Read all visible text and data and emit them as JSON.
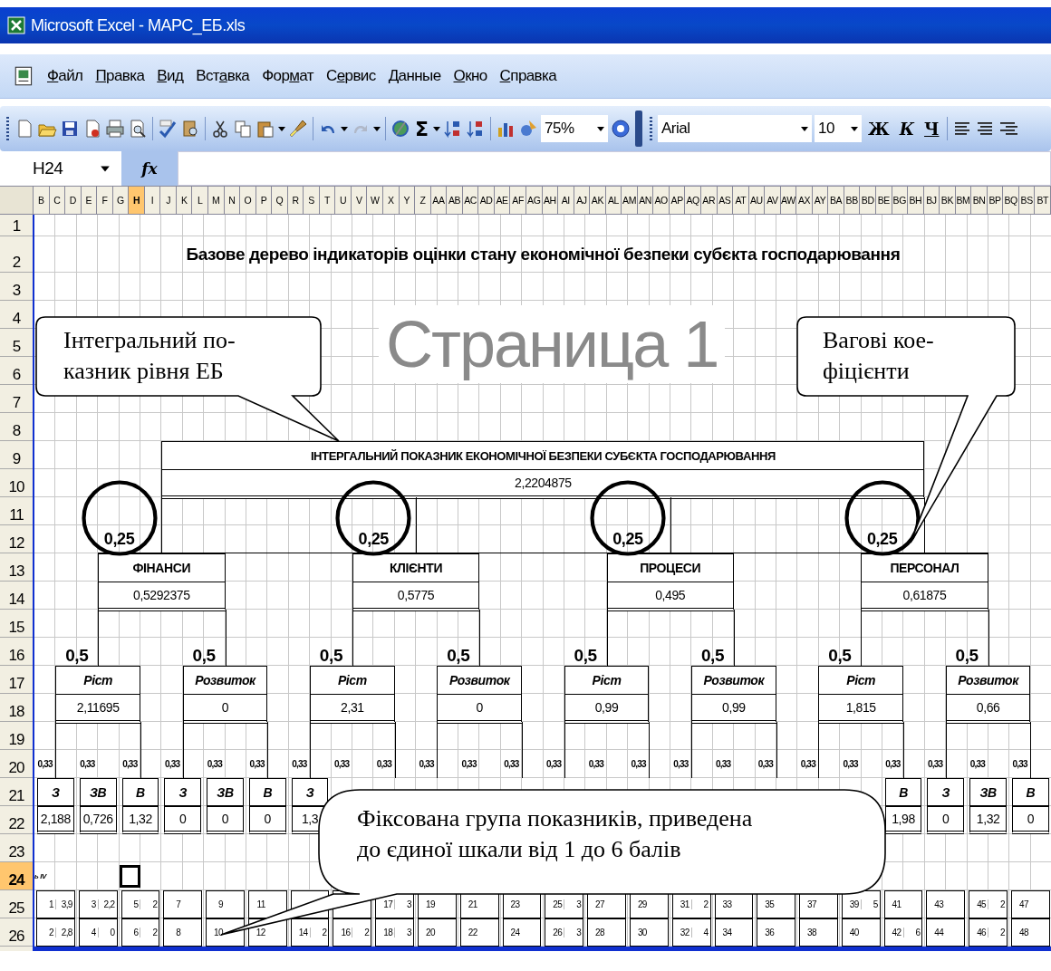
{
  "window": {
    "title": "Microsoft Excel - МАРС_ЕБ.xls"
  },
  "menu": [
    {
      "label": "Файл"
    },
    {
      "label": "Правка"
    },
    {
      "label": "Вид"
    },
    {
      "label": "Вставка"
    },
    {
      "label": "Формат"
    },
    {
      "label": "Сервис"
    },
    {
      "label": "Данные"
    },
    {
      "label": "Окно"
    },
    {
      "label": "Справка"
    }
  ],
  "toolbar": {
    "sum": "Σ",
    "zoom": "75%",
    "font": "Arial",
    "size": "10",
    "bold": "Ж",
    "italic": "К",
    "underline": "Ч"
  },
  "formula_bar": {
    "cell": "H24",
    "function_label": "fx"
  },
  "columns": [
    {
      "label": "B",
      "selected": false
    },
    {
      "label": "C",
      "selected": false
    },
    {
      "label": "D",
      "selected": false
    },
    {
      "label": "E",
      "selected": false
    },
    {
      "label": "F",
      "selected": false
    },
    {
      "label": "G",
      "selected": false
    },
    {
      "label": "H",
      "selected": true
    },
    {
      "label": "I",
      "selected": false
    },
    {
      "label": "J",
      "selected": false
    },
    {
      "label": "K",
      "selected": false
    },
    {
      "label": "L",
      "selected": false
    },
    {
      "label": "M",
      "selected": false
    },
    {
      "label": "N",
      "selected": false
    },
    {
      "label": "O",
      "selected": false
    },
    {
      "label": "P",
      "selected": false
    },
    {
      "label": "Q",
      "selected": false
    },
    {
      "label": "R",
      "selected": false
    },
    {
      "label": "S",
      "selected": false
    },
    {
      "label": "T",
      "selected": false
    },
    {
      "label": "U",
      "selected": false
    },
    {
      "label": "V",
      "selected": false
    },
    {
      "label": "W",
      "selected": false
    },
    {
      "label": "X",
      "selected": false
    },
    {
      "label": "Y",
      "selected": false
    },
    {
      "label": "Z",
      "selected": false
    },
    {
      "label": "AA",
      "selected": false
    },
    {
      "label": "AB",
      "selected": false
    },
    {
      "label": "AC",
      "selected": false
    },
    {
      "label": "AD",
      "selected": false
    },
    {
      "label": "AE",
      "selected": false
    },
    {
      "label": "AF",
      "selected": false
    },
    {
      "label": "AG",
      "selected": false
    },
    {
      "label": "AH",
      "selected": false
    },
    {
      "label": "AI",
      "selected": false
    },
    {
      "label": "AJ",
      "selected": false
    },
    {
      "label": "AK",
      "selected": false
    },
    {
      "label": "AL",
      "selected": false
    },
    {
      "label": "AM",
      "selected": false
    },
    {
      "label": "AN",
      "selected": false
    },
    {
      "label": "AO",
      "selected": false
    },
    {
      "label": "AP",
      "selected": false
    },
    {
      "label": "AQ",
      "selected": false
    },
    {
      "label": "AR",
      "selected": false
    },
    {
      "label": "AS",
      "selected": false
    },
    {
      "label": "AT",
      "selected": false
    },
    {
      "label": "AU",
      "selected": false
    },
    {
      "label": "AV",
      "selected": false
    },
    {
      "label": "AW",
      "selected": false
    },
    {
      "label": "AX",
      "selected": false
    },
    {
      "label": "AY",
      "selected": false
    },
    {
      "label": "BA",
      "selected": false
    },
    {
      "label": "BB",
      "selected": false
    },
    {
      "label": "BD",
      "selected": false
    },
    {
      "label": "BE",
      "selected": false
    },
    {
      "label": "BG",
      "selected": false
    },
    {
      "label": "BH",
      "selected": false
    },
    {
      "label": "BJ",
      "selected": false
    },
    {
      "label": "BK",
      "selected": false
    },
    {
      "label": "BM",
      "selected": false
    },
    {
      "label": "BN",
      "selected": false
    },
    {
      "label": "BP",
      "selected": false
    },
    {
      "label": "BQ",
      "selected": false
    },
    {
      "label": "BS",
      "selected": false
    },
    {
      "label": "BT",
      "selected": false
    }
  ],
  "rows": [
    {
      "label": "1",
      "selected": false
    },
    {
      "label": "2",
      "selected": false
    },
    {
      "label": "3",
      "selected": false
    },
    {
      "label": "4",
      "selected": false
    },
    {
      "label": "5",
      "selected": false
    },
    {
      "label": "6",
      "selected": false
    },
    {
      "label": "7",
      "selected": false
    },
    {
      "label": "8",
      "selected": false
    },
    {
      "label": "9",
      "selected": false
    },
    {
      "label": "10",
      "selected": false
    },
    {
      "label": "11",
      "selected": false
    },
    {
      "label": "12",
      "selected": false
    },
    {
      "label": "13",
      "selected": false
    },
    {
      "label": "14",
      "selected": false
    },
    {
      "label": "15",
      "selected": false
    },
    {
      "label": "16",
      "selected": false
    },
    {
      "label": "17",
      "selected": false
    },
    {
      "label": "18",
      "selected": false
    },
    {
      "label": "19",
      "selected": false
    },
    {
      "label": "20",
      "selected": false
    },
    {
      "label": "21",
      "selected": false
    },
    {
      "label": "22",
      "selected": false
    },
    {
      "label": "23",
      "selected": false
    },
    {
      "label": "24",
      "selected": true
    },
    {
      "label": "25",
      "selected": false
    },
    {
      "label": "26",
      "selected": false
    }
  ],
  "sheet": {
    "title": "Базове дерево індикаторів оцінки стану економічної безпеки субєкта господарювання",
    "root": {
      "label": "ІНТЕРГАЛЬНИЙ ПОКАЗНИК ЕКОНОМІЧНОЇ БЕЗПЕКИ СУБЄКТА ГОСПОДАРЮВАННЯ",
      "value": "2,2204875"
    },
    "branches": [
      {
        "weight": "0,25",
        "circled": true,
        "label": "ФІНАНСИ",
        "value": "0,5292375",
        "subs": [
          {
            "weight": "0,5",
            "label": "Ріст",
            "value": "2,11695"
          },
          {
            "weight": "0,5",
            "label": "Розвиток",
            "value": "0"
          }
        ]
      },
      {
        "weight": "0,25",
        "circled": true,
        "label": "КЛІЄНТИ",
        "value": "0,5775",
        "subs": [
          {
            "weight": "0,5",
            "label": "Ріст",
            "value": "2,31"
          },
          {
            "weight": "0,5",
            "label": "Розвиток",
            "value": "0"
          }
        ]
      },
      {
        "weight": "0,25",
        "circled": true,
        "label": "ПРОЦЕСИ",
        "value": "0,495",
        "subs": [
          {
            "weight": "0,5",
            "label": "Ріст",
            "value": "0,99"
          },
          {
            "weight": "0,5",
            "label": "Розвиток",
            "value": "0,99"
          }
        ]
      },
      {
        "weight": "0,25",
        "circled": true,
        "label": "ПЕРСОНАЛ",
        "value": "0,61875",
        "subs": [
          {
            "weight": "0,5",
            "label": "Ріст",
            "value": "1,815"
          },
          {
            "weight": "0,5",
            "label": "Розвиток",
            "value": "0,66"
          }
        ]
      }
    ],
    "leaves": [
      {
        "weight": "0,33",
        "label": "З",
        "value": "2,188",
        "r25": {
          "n": "1",
          "v": "3,9"
        },
        "r26": {
          "n": "2",
          "v": "2,8"
        }
      },
      {
        "weight": "0,33",
        "label": "ЗВ",
        "value": "0,726",
        "r25": {
          "n": "3",
          "v": "2,2"
        },
        "r26": {
          "n": "4",
          "v": "0"
        }
      },
      {
        "weight": "0,33",
        "label": "В",
        "value": "1,32",
        "r25": {
          "n": "5",
          "v": "2"
        },
        "r26": {
          "n": "6",
          "v": "2"
        }
      },
      {
        "weight": "0,33",
        "label": "З",
        "value": "0",
        "r25": {
          "n": "7"
        },
        "r26": {
          "n": "8"
        }
      },
      {
        "weight": "0,33",
        "label": "ЗВ",
        "value": "0",
        "r25": {
          "n": "9"
        },
        "r26": {
          "n": "10"
        }
      },
      {
        "weight": "0,33",
        "label": "В",
        "value": "0",
        "r25": {
          "n": "11"
        },
        "r26": {
          "n": "12"
        }
      },
      {
        "weight": "0,33",
        "label": "З",
        "value": "1,3",
        "r26": {
          "n": "14",
          "v": "2"
        }
      },
      {
        "weight": "0,33",
        "r26": {
          "n": "16",
          "v": "2"
        }
      },
      {
        "weight": "0,33",
        "r25": {
          "n": "17",
          "v": "3"
        },
        "r26": {
          "n": "18",
          "v": "3"
        }
      },
      {
        "weight": "0,33",
        "r25": {
          "n": "19"
        },
        "r26": {
          "n": "20"
        }
      },
      {
        "weight": "0,33",
        "r25": {
          "n": "21"
        },
        "r26": {
          "n": "22"
        }
      },
      {
        "weight": "0,33",
        "r25": {
          "n": "23"
        },
        "r26": {
          "n": "24"
        }
      },
      {
        "weight": "0,33",
        "r25": {
          "n": "25",
          "v": "3"
        },
        "r26": {
          "n": "26",
          "v": "3"
        }
      },
      {
        "weight": "0,33",
        "r25": {
          "n": "27"
        },
        "r26": {
          "n": "28"
        }
      },
      {
        "weight": "0,33",
        "r25": {
          "n": "29"
        },
        "r26": {
          "n": "30"
        }
      },
      {
        "weight": "0,33",
        "r25": {
          "n": "31",
          "v": "2"
        },
        "r26": {
          "n": "32",
          "v": "4"
        }
      },
      {
        "weight": "0,33",
        "r25": {
          "n": "33"
        },
        "r26": {
          "n": "34"
        }
      },
      {
        "weight": "0,33",
        "r25": {
          "n": "35"
        },
        "r26": {
          "n": "36"
        }
      },
      {
        "weight": "0,33",
        "r25": {
          "n": "37"
        },
        "r26": {
          "n": "38"
        }
      },
      {
        "weight": "0,33",
        "r25": {
          "n": "39",
          "v": "5"
        },
        "r26": {
          "n": "40"
        }
      },
      {
        "weight": "0,33",
        "label": "В",
        "value": "1,98",
        "r25": {
          "n": "41"
        },
        "r26": {
          "n": "42",
          "v": "6"
        }
      },
      {
        "weight": "0,33",
        "label": "З",
        "value": "0",
        "r25": {
          "n": "43"
        },
        "r26": {
          "n": "44"
        }
      },
      {
        "weight": "0,33",
        "label": "ЗВ",
        "value": "1,32",
        "r25": {
          "n": "45",
          "v": "2"
        },
        "r26": {
          "n": "46",
          "v": "2"
        }
      },
      {
        "weight": "0,33",
        "label": "В",
        "value": "0",
        "r25": {
          "n": "47"
        },
        "r26": {
          "n": "48"
        }
      }
    ],
    "cell_note": "ь IV",
    "watermark": "Страница 1"
  },
  "callouts": [
    {
      "text": "Інтегральний по-\nказник рівня ЕБ"
    },
    {
      "text": "Вагові кое-\nфіцієнти"
    },
    {
      "text": "Фіксована група показників, приведена\nдо єдиної шкали від 1 до 6 балів"
    }
  ]
}
